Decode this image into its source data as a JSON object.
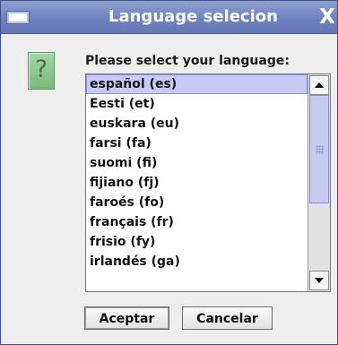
{
  "dialog": {
    "title": "Language selecion",
    "close_label": "X",
    "prompt": "Please select your language:"
  },
  "languages": [
    "español (es)",
    "Eesti (et)",
    "euskara (eu)",
    "farsi (fa)",
    "suomi (fi)",
    "fijiano (fj)",
    "faroés (fo)",
    "français (fr)",
    "frisio (fy)",
    "irlandés (ga)"
  ],
  "selected_language": "español (es)",
  "buttons": {
    "ok": "Aceptar",
    "cancel": "Cancelar"
  },
  "colors": {
    "titlebar": "#7182bd",
    "selection": "#c8cbf5",
    "question_icon": "#8fc78f"
  },
  "icons": {
    "window_menu": "window-menu-icon",
    "question": "question-mark-icon",
    "scroll_up": "arrow-up-icon",
    "scroll_down": "arrow-down-icon"
  }
}
